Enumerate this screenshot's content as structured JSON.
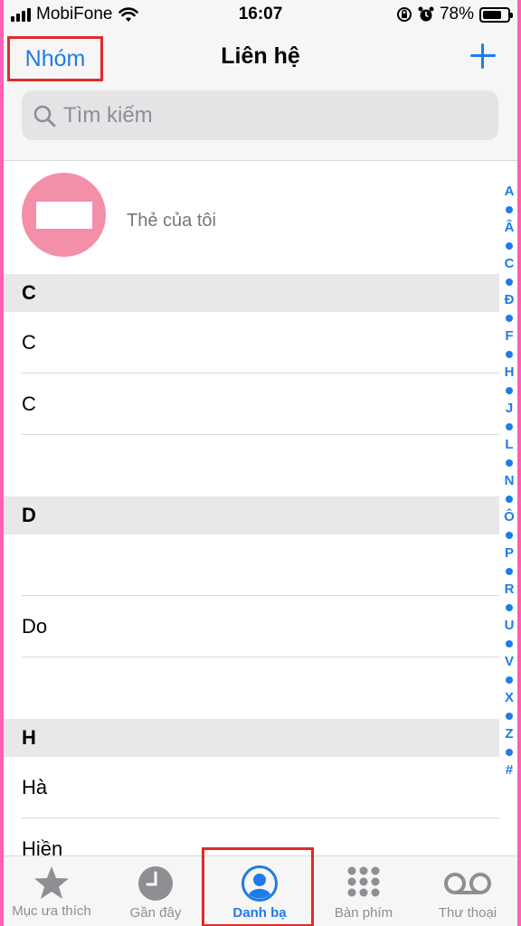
{
  "status_bar": {
    "carrier": "MobiFone",
    "time": "16:07",
    "battery": "78%",
    "battery_level": 0.78
  },
  "nav": {
    "groups_label": "Nhóm",
    "title": "Liên hệ",
    "add_icon": "plus-icon"
  },
  "search": {
    "placeholder": "Tìm kiếm",
    "value": ""
  },
  "my_card": {
    "subtitle": "Thẻ của tôi"
  },
  "sections": [
    {
      "letter": "C",
      "rows": [
        "C",
        "C",
        ""
      ]
    },
    {
      "letter": "D",
      "rows": [
        "",
        "Do",
        ""
      ]
    },
    {
      "letter": "H",
      "rows": [
        "Hà",
        "Hiền"
      ]
    }
  ],
  "index_letters": [
    "A",
    "Â",
    "C",
    "Đ",
    "F",
    "H",
    "J",
    "L",
    "N",
    "Ô",
    "P",
    "R",
    "U",
    "V",
    "X",
    "Z",
    "#"
  ],
  "tabs": [
    {
      "label": "Mục ưa thích",
      "icon": "star-icon",
      "active": false
    },
    {
      "label": "Gần đây",
      "icon": "clock-icon",
      "active": false
    },
    {
      "label": "Danh bạ",
      "icon": "person-circle-icon",
      "active": true
    },
    {
      "label": "Bàn phím",
      "icon": "keypad-icon",
      "active": false
    },
    {
      "label": "Thư thoại",
      "icon": "voicemail-icon",
      "active": false
    }
  ],
  "colors": {
    "accent": "#1f7bea",
    "highlight_border": "#e02a2a",
    "avatar": "#f38fa9"
  }
}
